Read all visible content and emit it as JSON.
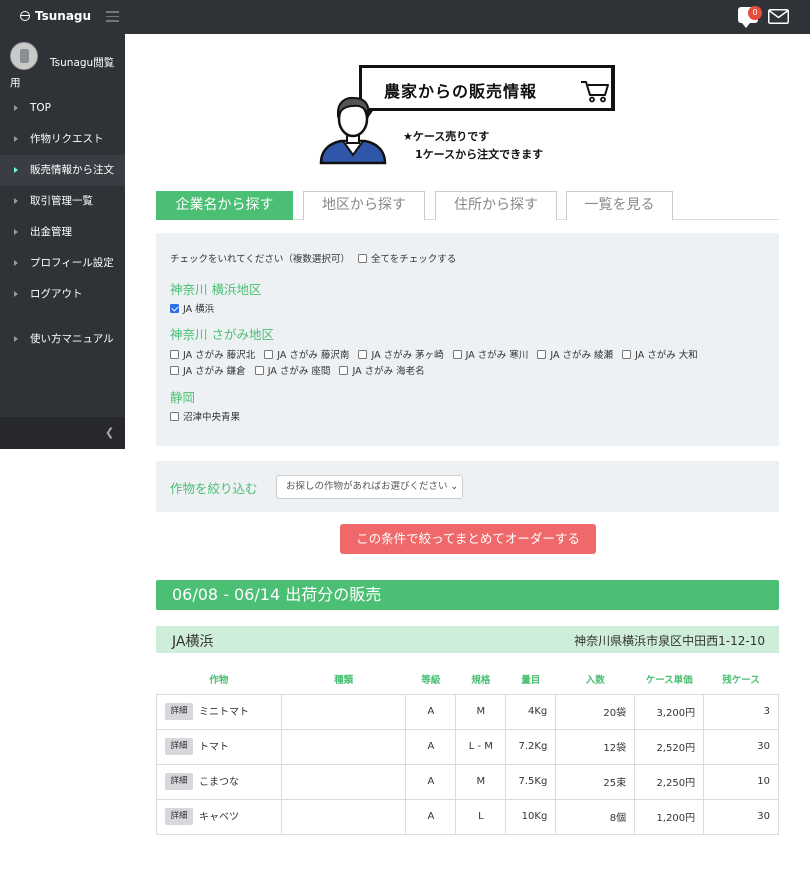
{
  "brand": "Tsunagu",
  "header": {
    "notification_count": "0"
  },
  "user": {
    "name": "Tsunagu閲覧用"
  },
  "nav": [
    {
      "label": "TOP"
    },
    {
      "label": "作物リクエスト"
    },
    {
      "label": "販売情報から注文"
    },
    {
      "label": "取引管理一覧"
    },
    {
      "label": "出金管理"
    },
    {
      "label": "プロフィール設定"
    },
    {
      "label": "ログアウト"
    },
    {
      "label": "使い方マニュアル"
    }
  ],
  "hero": {
    "title": "農家からの販売情報",
    "note1": "★ケース売りです",
    "note2": "1ケースから注文できます"
  },
  "tabs": [
    {
      "label": "企業名から探す",
      "active": true
    },
    {
      "label": "地区から探す"
    },
    {
      "label": "住所から探す"
    },
    {
      "label": "一覧を見る"
    }
  ],
  "panel": {
    "hint": "チェックをいれてください（複数選択可）",
    "check_all": "全てをチェックする",
    "regions": [
      {
        "name": "神奈川 横浜地区",
        "options": [
          {
            "label": "JA 横浜",
            "checked": true
          }
        ]
      },
      {
        "name": "神奈川 さがみ地区",
        "options": [
          {
            "label": "JA さがみ 藤沢北"
          },
          {
            "label": "JA さがみ 藤沢南"
          },
          {
            "label": "JA さがみ 茅ヶ崎"
          },
          {
            "label": "JA さがみ 寒川"
          },
          {
            "label": "JA さがみ 綾瀬"
          },
          {
            "label": "JA さがみ 大和"
          },
          {
            "label": "JA さがみ 鎌倉"
          },
          {
            "label": "JA さがみ 座間"
          },
          {
            "label": "JA さがみ 海老名"
          }
        ]
      },
      {
        "name": "静岡",
        "options": [
          {
            "label": "沼津中央青果"
          }
        ]
      }
    ]
  },
  "filter": {
    "label": "作物を絞り込む",
    "select_value": "お探しの作物があればお選びください"
  },
  "order_button": "この条件で絞ってまとめてオーダーする",
  "section_title": "06/08 - 06/14 出荷分の販売",
  "vendor": {
    "name": "JA横浜",
    "address": "神奈川県横浜市泉区中田西1-12-10"
  },
  "table": {
    "headers": [
      "作物",
      "種類",
      "等級",
      "規格",
      "量目",
      "入数",
      "ケース単価",
      "残ケース"
    ],
    "detail_label": "詳細",
    "rows": [
      {
        "crop": "ミニトマト",
        "kind": "",
        "grade": "A",
        "size": "M",
        "weight": "4Kg",
        "count": "20袋",
        "price": "3,200円",
        "remaining": "3"
      },
      {
        "crop": "トマト",
        "kind": "",
        "grade": "A",
        "size": "L - M",
        "weight": "7.2Kg",
        "count": "12袋",
        "price": "2,520円",
        "remaining": "30"
      },
      {
        "crop": "こまつな",
        "kind": "",
        "grade": "A",
        "size": "M",
        "weight": "7.5Kg",
        "count": "25束",
        "price": "2,250円",
        "remaining": "10"
      },
      {
        "crop": "キャベツ",
        "kind": "",
        "grade": "A",
        "size": "L",
        "weight": "10Kg",
        "count": "8個",
        "price": "1,200円",
        "remaining": "30"
      }
    ]
  }
}
